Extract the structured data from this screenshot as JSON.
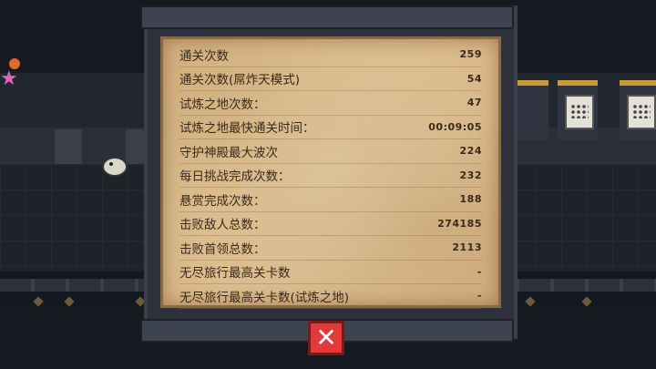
{
  "stats": [
    {
      "label": "通关次数",
      "value": "259"
    },
    {
      "label": "通关次数(屌炸天模式)",
      "value": "54"
    },
    {
      "label": "试炼之地次数：",
      "value": "47"
    },
    {
      "label": "试炼之地最快通关时间：",
      "value": "00:09:05"
    },
    {
      "label": "守护神殿最大波次",
      "value": "224"
    },
    {
      "label": "每日挑战完成次数：",
      "value": "232"
    },
    {
      "label": "悬赏完成次数：",
      "value": "188"
    },
    {
      "label": "击败敌人总数：",
      "value": "274185"
    },
    {
      "label": "击败首领总数：",
      "value": "2113"
    },
    {
      "label": "无尽旅行最高关卡数",
      "value": "-"
    },
    {
      "label": "无尽旅行最高关卡数(试炼之地)",
      "value": "-"
    }
  ],
  "close_button": {
    "icon": "close-icon",
    "glyph": "✕"
  },
  "colors": {
    "parchment": "#e3c79a",
    "close": "#e23a3a",
    "text": "#3b2a1a"
  }
}
